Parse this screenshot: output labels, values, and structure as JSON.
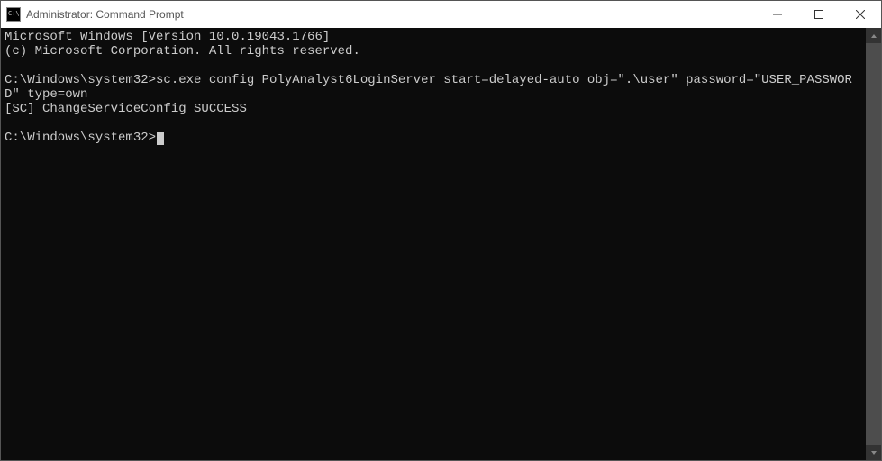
{
  "window": {
    "title": "Administrator: Command Prompt"
  },
  "console": {
    "banner_line1": "Microsoft Windows [Version 10.0.19043.1766]",
    "banner_line2": "(c) Microsoft Corporation. All rights reserved.",
    "blank1": "",
    "prompt1_path": "C:\\Windows\\system32>",
    "command1": "sc.exe config PolyAnalyst6LoginServer start=delayed-auto obj=\".\\user\" password=\"USER_PASSWORD\" type=own",
    "result1": "[SC] ChangeServiceConfig SUCCESS",
    "blank2": "",
    "prompt2_path": "C:\\Windows\\system32>"
  }
}
